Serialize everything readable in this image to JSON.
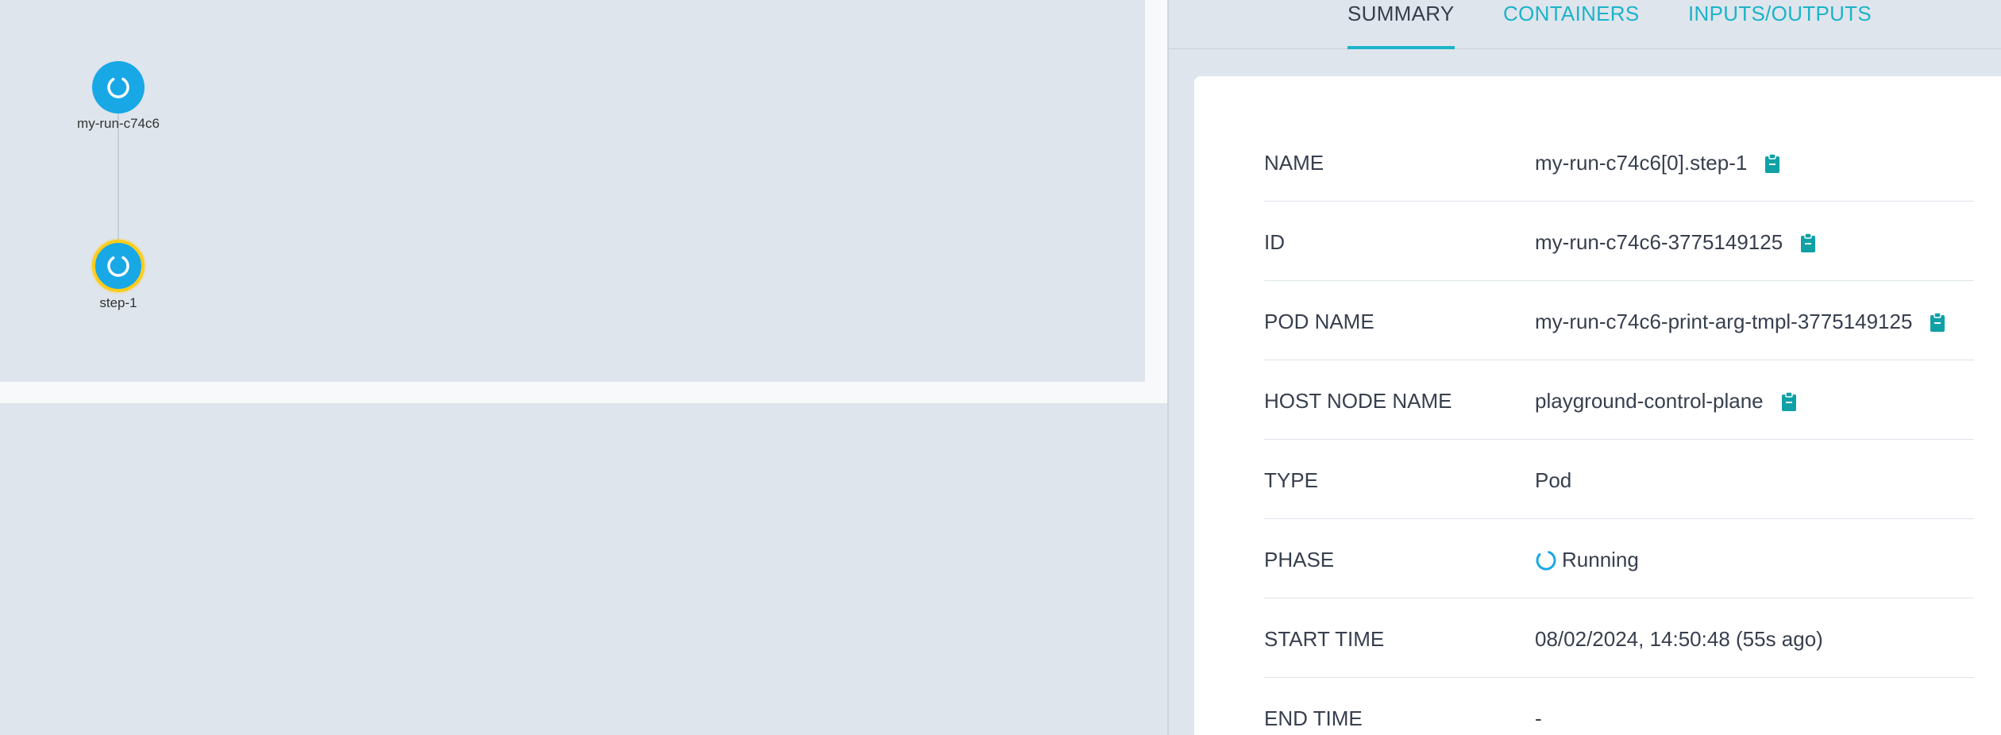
{
  "graph": {
    "nodes": [
      {
        "label": "my-run-c74c6",
        "icon": "running-icon"
      },
      {
        "label": "step-1",
        "icon": "running-icon"
      }
    ]
  },
  "tabs": [
    {
      "label": "SUMMARY",
      "active": true
    },
    {
      "label": "CONTAINERS",
      "active": false
    },
    {
      "label": "INPUTS/OUTPUTS",
      "active": false
    }
  ],
  "summary": {
    "rows": [
      {
        "label": "NAME",
        "value": "my-run-c74c6[0].step-1",
        "copy": true
      },
      {
        "label": "ID",
        "value": "my-run-c74c6-3775149125",
        "copy": true
      },
      {
        "label": "POD NAME",
        "value": "my-run-c74c6-print-arg-tmpl-3775149125",
        "copy": true
      },
      {
        "label": "HOST NODE NAME",
        "value": "playground-control-plane",
        "copy": true
      },
      {
        "label": "TYPE",
        "value": "Pod",
        "copy": false
      },
      {
        "label": "PHASE",
        "value": "Running",
        "copy": false,
        "icon": "running-icon"
      },
      {
        "label": "START TIME",
        "value": "08/02/2024, 14:50:48 (55s ago)",
        "copy": false
      },
      {
        "label": "END TIME",
        "value": "-",
        "copy": false
      }
    ]
  },
  "colors": {
    "accent": "#1cb3c8",
    "node": "#18a8e6",
    "selected": "#ffcc19",
    "clipboard": "#0fa1a6"
  }
}
